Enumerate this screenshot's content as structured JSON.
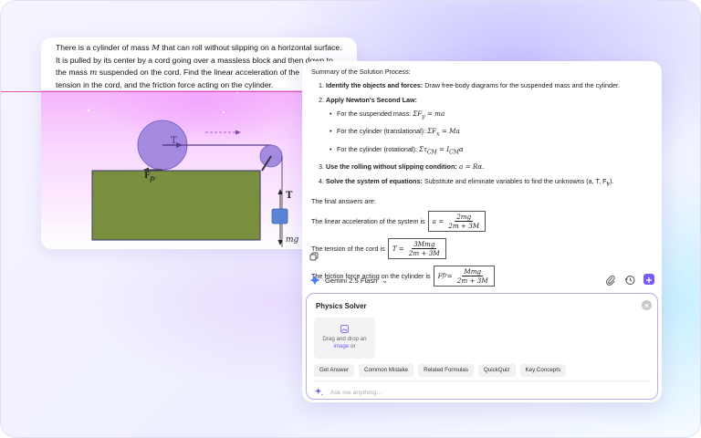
{
  "problem": {
    "text_before_m": "There is a cylinder of mass ",
    "mass_symbol": "M",
    "text_after_m": " that can roll without slipping on a horizontal surface. It is pulled by its center by a cord going over a massless block and then down to the mass ",
    "small_mass_symbol": "m",
    "text_end": " suspended on the cord. Find the linear acceleration of the system, the tension in the cord, and the friction force acting on the cylinder.",
    "diagram_labels": {
      "tension_cylinder": "T",
      "friction": "F",
      "friction_sub": "fr",
      "tension_hanging": "T",
      "weight": "mg"
    },
    "colors": {
      "table": "#7a8f3d",
      "cylinder": "#a48ae0",
      "block": "#5b84d6"
    }
  },
  "solution": {
    "summary_label": "Summary of the Solution Process:",
    "steps": [
      {
        "num": "1.",
        "title": "Identify the objects and forces:",
        "text": " Draw free-body diagrams for the suspended mass and the cylinder."
      },
      {
        "num": "2.",
        "title": "Apply Newton's Second Law:",
        "text": ""
      },
      {
        "num": "3.",
        "title": "Use the rolling without slipping condition:",
        "text": " a = Rα."
      },
      {
        "num": "4.",
        "title": "Solve the system of equations:",
        "text": " Substitute and eliminate variables to find the unknowns (a, T, F",
        "text_sub": "fr",
        "text_end": ")."
      }
    ],
    "bullets": [
      {
        "label": "For the suspended mass: ",
        "eq": "ΣF",
        "eq_sub": "y",
        "eq_rest": " = ma"
      },
      {
        "label": "For the cylinder (translational): ",
        "eq": "ΣF",
        "eq_sub": "x",
        "eq_rest": " = Ma"
      },
      {
        "label": "For the cylinder (rotational): ",
        "eq": "Στ",
        "eq_sub": "CM",
        "eq_rest": " = I",
        "eq_sub2": "CM",
        "eq_rest2": "α"
      }
    ],
    "final_label": "The final answers are:",
    "answers": [
      {
        "text": "The linear acceleration of the system is",
        "lhs": "a =",
        "num": "2mg",
        "den": "2m + 3M"
      },
      {
        "text": "The tension of the cord is",
        "lhs": "T =",
        "num": "3Mmg",
        "den": "2m + 3M"
      },
      {
        "text": "The friction force acting on the cylinder is",
        "lhs": "F",
        "lhs_sub": "fr",
        "lhs_eq": " =",
        "num": "Mmg",
        "den": "2m + 3M"
      }
    ]
  },
  "toolbar": {
    "model_name": "Gemini 2.5 Flash",
    "icons": [
      "copy-icon",
      "gemini-sparkle-icon",
      "chevron-down-icon",
      "paperclip-icon",
      "history-icon",
      "new-chat-icon"
    ]
  },
  "solver": {
    "title": "Physics Solver",
    "dropzone_text1": "Drag and drop an",
    "dropzone_link": "image",
    "dropzone_text2": " or",
    "chips": [
      "Get Answer",
      "Common Mistake",
      "Related Formulas",
      "QuickQuiz",
      "Key Concepts"
    ],
    "ask_placeholder": "Ask me anything..."
  },
  "accent_color": "#7a5af5"
}
